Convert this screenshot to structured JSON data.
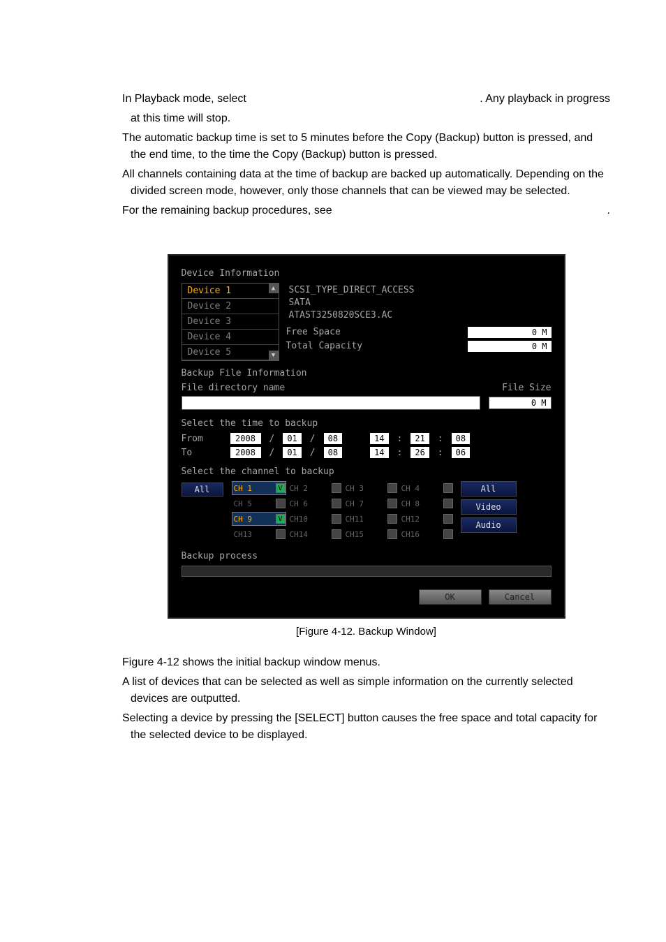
{
  "intro": {
    "p1a": "In Playback mode, select ",
    "p1b": ". Any playback in progress",
    "p1c": "at this time will stop.",
    "p2": "The automatic backup time is set to 5 minutes before the Copy (Backup) button is pressed, and the end time, to the time the Copy (Backup) button is pressed.",
    "p3": "All channels containing data at the time of backup are backed up automatically. Depending on the divided screen mode, however, only those channels that can be viewed may be selected.",
    "p4a": "For the remaining backup procedures, see ",
    "p4b": "."
  },
  "dialog": {
    "section_device_info": "Device Information",
    "devices": {
      "d1": "Device 1",
      "d2": "Device 2",
      "d3": "Device 3",
      "d4": "Device 4",
      "d5": "Device 5"
    },
    "dev_desc_l1": "SCSI_TYPE_DIRECT_ACCESS",
    "dev_desc_l2": "SATA",
    "dev_desc_l3": "ATAST3250820SCE3.AC",
    "free_space_label": "Free Space",
    "free_space_val": "0 M",
    "total_cap_label": "Total Capacity",
    "total_cap_val": "0 M",
    "section_file_info": "Backup File Information",
    "file_dir_label": "File directory name",
    "file_size_label": "File Size",
    "file_size_val": "0 M",
    "section_time": "Select the time to backup",
    "from_label": "From",
    "to_label": "To",
    "from": {
      "yyyy": "2008",
      "mm": "01",
      "dd": "08",
      "h": "14",
      "m": "21",
      "s": "08"
    },
    "to": {
      "yyyy": "2008",
      "mm": "01",
      "dd": "08",
      "h": "14",
      "m": "26",
      "s": "06"
    },
    "section_channel": "Select the channel to backup",
    "btn_all_left": "All",
    "btn_all_right": "All",
    "btn_video": "Video",
    "btn_audio": "Audio",
    "channels": {
      "c1": "CH 1",
      "c2": "CH 2",
      "c3": "CH 3",
      "c4": "CH 4",
      "c5": "CH 5",
      "c6": "CH 6",
      "c7": "CH 7",
      "c8": "CH 8",
      "c9": "CH 9",
      "c10": "CH10",
      "c11": "CH11",
      "c12": "CH12",
      "c13": "CH13",
      "c14": "CH14",
      "c15": "CH15",
      "c16": "CH16"
    },
    "check_mark": "V",
    "section_backup_process": "Backup process",
    "btn_ok": "OK",
    "btn_cancel": "Cancel"
  },
  "caption": "[Figure 4-12. Backup Window]",
  "outro": {
    "p1": "Figure 4-12 shows the initial backup window menus.",
    "p2": "A list of devices that can be selected as well as simple information on the currently selected devices are outputted.",
    "p3": "Selecting a device by pressing the [SELECT] button causes the free space and total capacity for the selected device to be displayed."
  }
}
